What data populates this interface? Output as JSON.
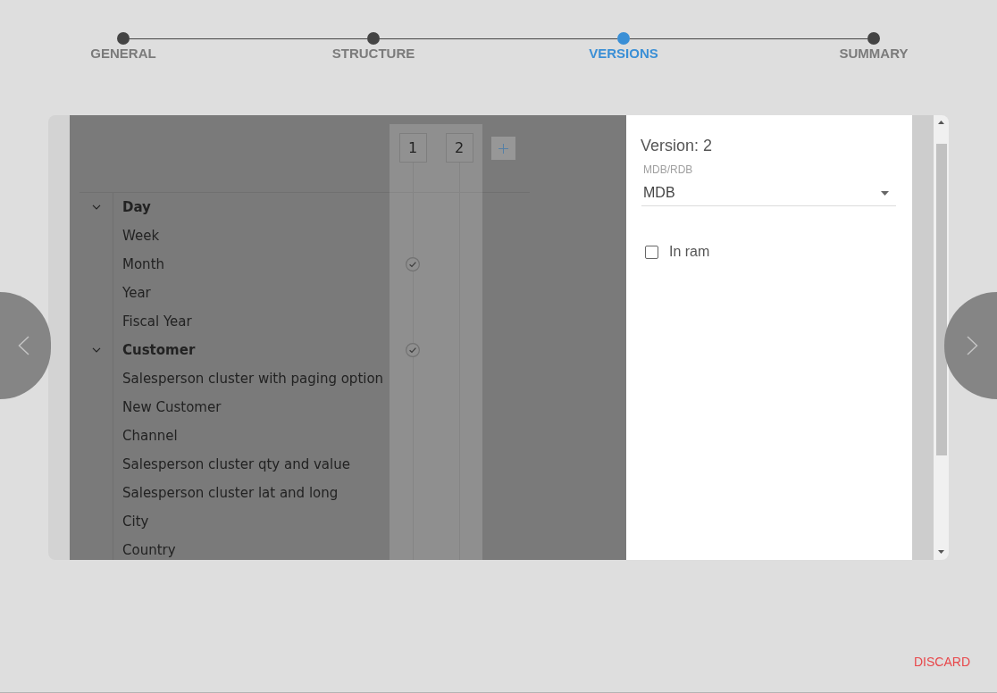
{
  "stepper": {
    "steps": [
      {
        "label": "GENERAL",
        "selected": false
      },
      {
        "label": "STRUCTURE",
        "selected": false
      },
      {
        "label": "VERSIONS",
        "selected": true
      },
      {
        "label": "SUMMARY",
        "selected": false
      }
    ]
  },
  "versions": [
    {
      "label": "1"
    },
    {
      "label": "2"
    }
  ],
  "tree": [
    {
      "label": "Day",
      "expanded": true,
      "checks": [
        false,
        false
      ],
      "children": [
        {
          "label": "Week",
          "checks": [
            false,
            false
          ]
        },
        {
          "label": "Month",
          "checks": [
            true,
            false
          ]
        },
        {
          "label": "Year",
          "checks": [
            false,
            false
          ]
        },
        {
          "label": "Fiscal Year",
          "checks": [
            false,
            false
          ]
        }
      ]
    },
    {
      "label": "Customer",
      "expanded": true,
      "checks": [
        true,
        false
      ],
      "children": [
        {
          "label": "Salesperson cluster with paging option",
          "checks": [
            false,
            false
          ]
        },
        {
          "label": "New Customer",
          "checks": [
            false,
            false
          ]
        },
        {
          "label": "Channel",
          "checks": [
            false,
            false
          ]
        },
        {
          "label": "Salesperson cluster qty and value",
          "checks": [
            false,
            false
          ]
        },
        {
          "label": "Salesperson cluster lat and long",
          "checks": [
            false,
            false
          ]
        },
        {
          "label": "City",
          "checks": [
            false,
            false
          ]
        },
        {
          "label": "Country",
          "checks": [
            false,
            false
          ]
        }
      ]
    }
  ],
  "version_panel": {
    "title": "Version: 2",
    "storage_select": {
      "label": "MDB/RDB",
      "value": "MDB"
    },
    "in_ram": {
      "label": "In ram",
      "checked": false
    }
  },
  "discard_button": "DISCARD"
}
